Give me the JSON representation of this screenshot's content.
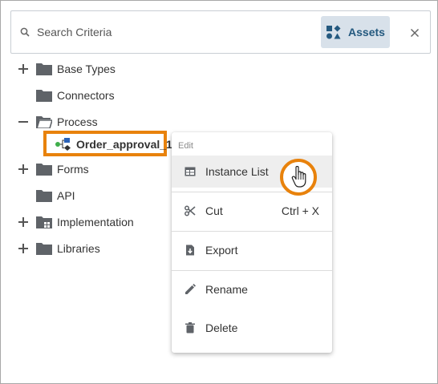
{
  "search": {
    "placeholder": "Search Criteria",
    "assets_label": "Assets"
  },
  "tree": {
    "items": [
      {
        "label": "Base Types",
        "expander": "plus",
        "icon": "folder-icon"
      },
      {
        "label": "Connectors",
        "expander": "none",
        "icon": "folder-icon"
      },
      {
        "label": "Process",
        "expander": "minus",
        "icon": "folder-open-icon"
      },
      {
        "label": "Order_approval_1",
        "expander": "none",
        "icon": "process-icon",
        "selected": true
      },
      {
        "label": "Forms",
        "expander": "plus",
        "icon": "folder-icon"
      },
      {
        "label": "API",
        "expander": "none",
        "icon": "folder-icon"
      },
      {
        "label": "Implementation",
        "expander": "plus",
        "icon": "folder-grid-icon"
      },
      {
        "label": "Libraries",
        "expander": "plus",
        "icon": "folder-icon"
      }
    ]
  },
  "context_menu": {
    "header": "Edit",
    "items": [
      {
        "label": "Instance List",
        "icon": "table-icon",
        "shortcut": ""
      },
      {
        "label": "Cut",
        "icon": "scissors-icon",
        "shortcut": "Ctrl + X"
      },
      {
        "label": "Export",
        "icon": "export-icon",
        "shortcut": ""
      },
      {
        "label": "Rename",
        "icon": "pencil-icon",
        "shortcut": ""
      },
      {
        "label": "Delete",
        "icon": "trash-icon",
        "shortcut": ""
      }
    ]
  },
  "colors": {
    "highlight": "#e8820c",
    "assets_bg": "#d8e1ea",
    "assets_text": "#24597f",
    "folder": "#5f6368"
  }
}
